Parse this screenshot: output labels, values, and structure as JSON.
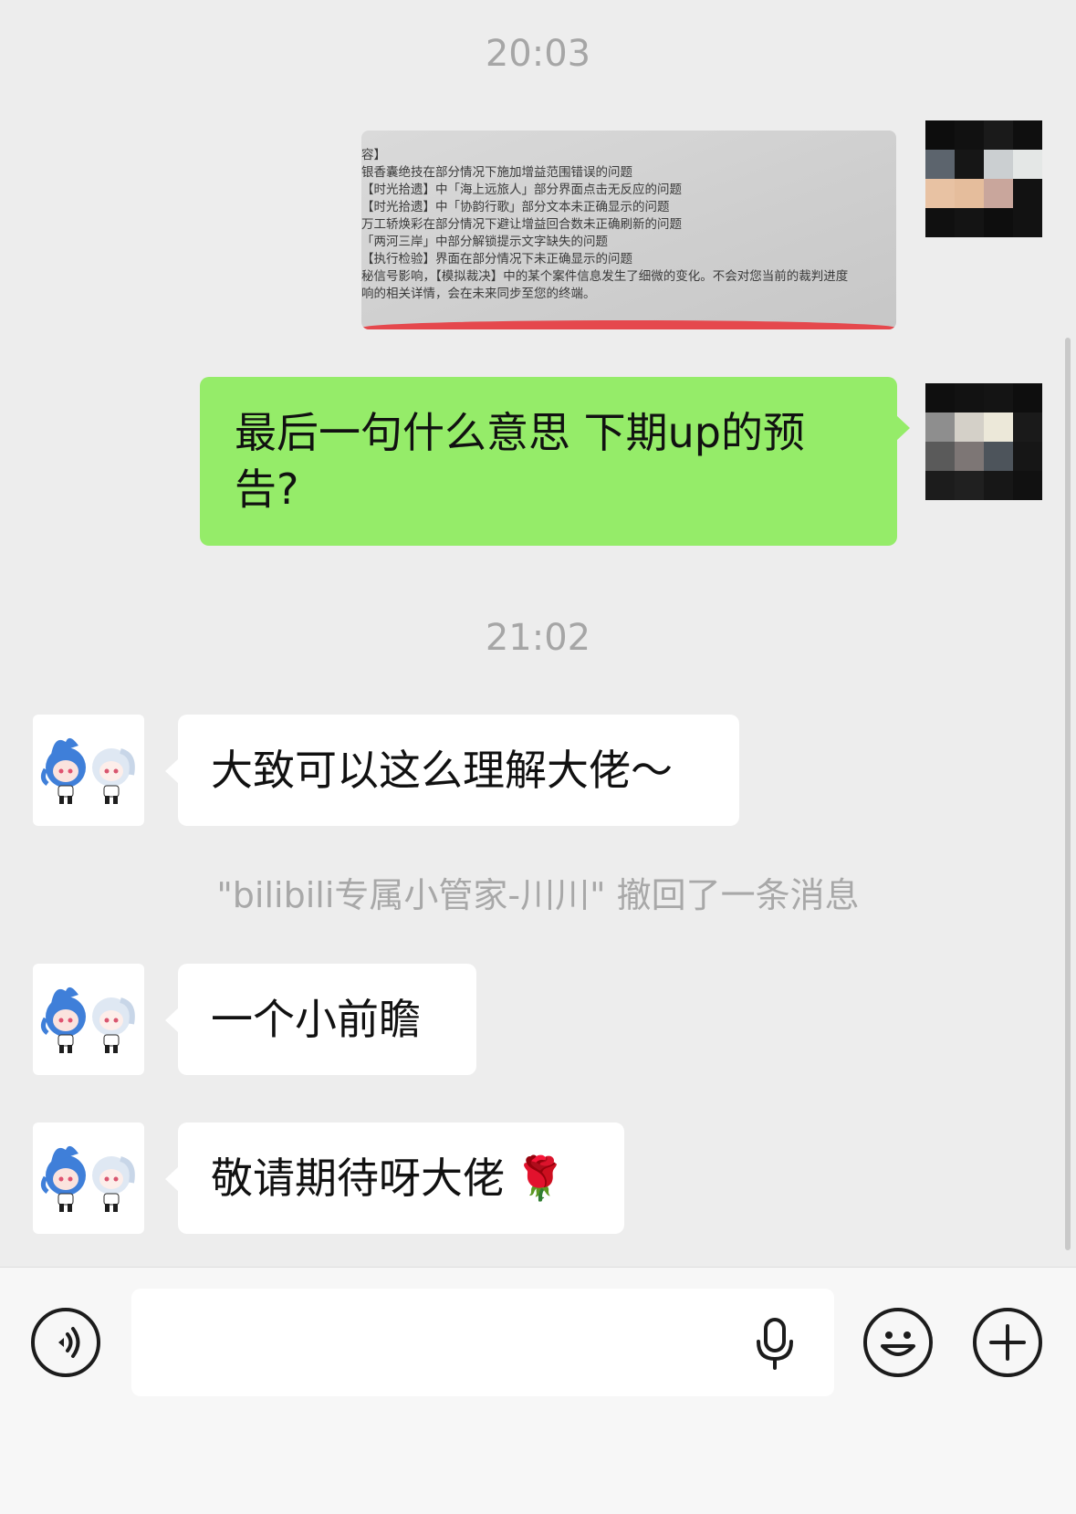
{
  "timestamps": [
    "20:03",
    "21:02"
  ],
  "image_message": {
    "lines": [
      "容】",
      "银香囊绝技在部分情况下施加增益范围错误的问题",
      "【时光拾遗】中「海上远旅人」部分界面点击无反应的问题",
      "【时光拾遗】中「协韵行歌」部分文本未正确显示的问题",
      "万工轿焕彩在部分情况下避让增益回合数未正确刷新的问题",
      "「两河三岸」中部分解锁提示文字缺失的问题",
      "【执行检验】界面在部分情况下未正确显示的问题",
      "秘信号影响，【模拟裁决】中的某个案件信息发生了细微的变化。不会对您当前的裁判进度",
      "响的相关详情，会在未来同步至您的终端。"
    ]
  },
  "messages": {
    "outgoing_1": "最后一句什么意思 下期up的预告?",
    "incoming_1": "大致可以这么理解大佬～",
    "incoming_2": "一个小前瞻",
    "incoming_3": "敬请期待呀大佬",
    "incoming_3_emoji": "🌹"
  },
  "recall_notice": "\"bilibili专属小管家-川川\" 撤回了一条消息",
  "input_bar": {
    "voice_icon": "voice-icon",
    "mic_icon": "microphone-icon",
    "emoji_icon": "emoji-icon",
    "plus_icon": "plus-icon",
    "input_value": ""
  },
  "colors": {
    "background": "#ededed",
    "outgoing_bubble": "#95ec69",
    "incoming_bubble": "#ffffff",
    "timestamp_text": "#a6a6a6"
  }
}
